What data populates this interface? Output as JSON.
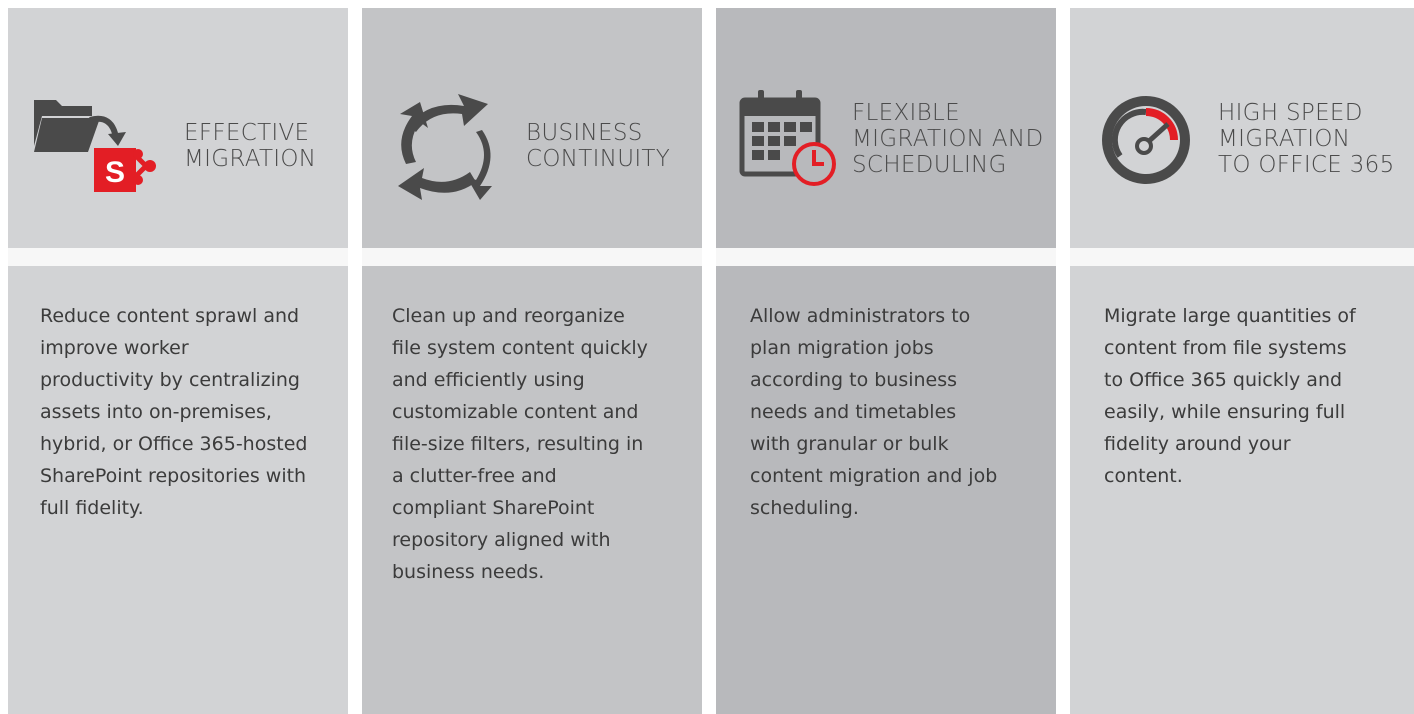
{
  "features": [
    {
      "icon": "sharepoint-migration-icon",
      "title": "EFFECTIVE\nMIGRATION",
      "description": "Reduce content sprawl and\nimprove worker\nproductivity by centralizing\nassets into on-premises,\nhybrid, or Office 365-hosted\nSharePoint repositories with\nfull fidelity."
    },
    {
      "icon": "cycle-arrows-icon",
      "title": "BUSINESS\nCONTINUITY",
      "description": "Clean up and reorganize\nfile system content quickly\nand efficiently using\ncustomizable content and\nfile-size filters, resulting in\na clutter-free and\ncompliant SharePoint\nrepository aligned with\nbusiness needs."
    },
    {
      "icon": "calendar-clock-icon",
      "title": "FLEXIBLE\nMIGRATION AND\nSCHEDULING",
      "description": "Allow administrators to\nplan migration jobs\naccording to business\nneeds and timetables\nwith granular or bulk\ncontent migration and job\nscheduling."
    },
    {
      "icon": "speedometer-icon",
      "title": "HIGH SPEED\nMIGRATION\nTO OFFICE 365",
      "description": "Migrate large quantities of\ncontent from file systems\nto Office 365 quickly and\neasily, while ensuring full\nfidelity around your\ncontent."
    }
  ],
  "colors": {
    "icon_dark": "#4a4a4a",
    "accent_red": "#e31e25",
    "panel_light": "#d2d3d5",
    "panel_mid": "#c3c4c6",
    "panel_dark": "#b8b9bc"
  }
}
